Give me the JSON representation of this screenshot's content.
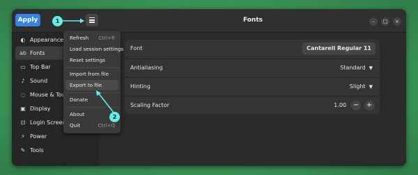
{
  "header": {
    "apply_label": "Apply",
    "title": "Fonts",
    "minimize_glyph": "–",
    "maximize_glyph": "□",
    "close_glyph": "×"
  },
  "sidebar": {
    "items": [
      {
        "label": "Appearance",
        "icon": "appearance-icon",
        "glyph": "◐"
      },
      {
        "label": "Fonts",
        "icon": "fonts-icon",
        "glyph": "ab"
      },
      {
        "label": "Top Bar",
        "icon": "top-bar-icon",
        "glyph": "▭"
      },
      {
        "label": "Sound",
        "icon": "sound-icon",
        "glyph": "♪"
      },
      {
        "label": "Mouse & Touchpad",
        "icon": "mouse-icon",
        "glyph": "◌"
      },
      {
        "label": "Display",
        "icon": "display-icon",
        "glyph": "▣"
      },
      {
        "label": "Login Screen",
        "icon": "login-screen-icon",
        "glyph": "⊡"
      },
      {
        "label": "Power",
        "icon": "power-icon",
        "glyph": "⚡"
      },
      {
        "label": "Tools",
        "icon": "tools-icon",
        "glyph": "✎"
      }
    ]
  },
  "settings": {
    "font_label": "Font",
    "font_value": "Cantarell Regular  11",
    "antialiasing_label": "Antialiasing",
    "antialiasing_value": "Standard",
    "hinting_label": "Hinting",
    "hinting_value": "Slight",
    "scaling_label": "Scaling Factor",
    "scaling_value": "1.00",
    "minus_glyph": "−",
    "plus_glyph": "+"
  },
  "menu": {
    "refresh": "Refresh",
    "refresh_shortcut": "Ctrl+R",
    "load": "Load session settings",
    "reset": "Reset settings",
    "import": "Import from file",
    "export": "Export to file",
    "donate": "Donate",
    "about": "About",
    "quit": "Quit",
    "quit_shortcut": "Ctrl+Q"
  },
  "annotations": {
    "badge1": "1",
    "badge2": "2",
    "color": "#5ff0e8"
  },
  "colors": {
    "accent": "#3584e4",
    "window": "#2b2b2b",
    "background": "#3d9a5a"
  }
}
